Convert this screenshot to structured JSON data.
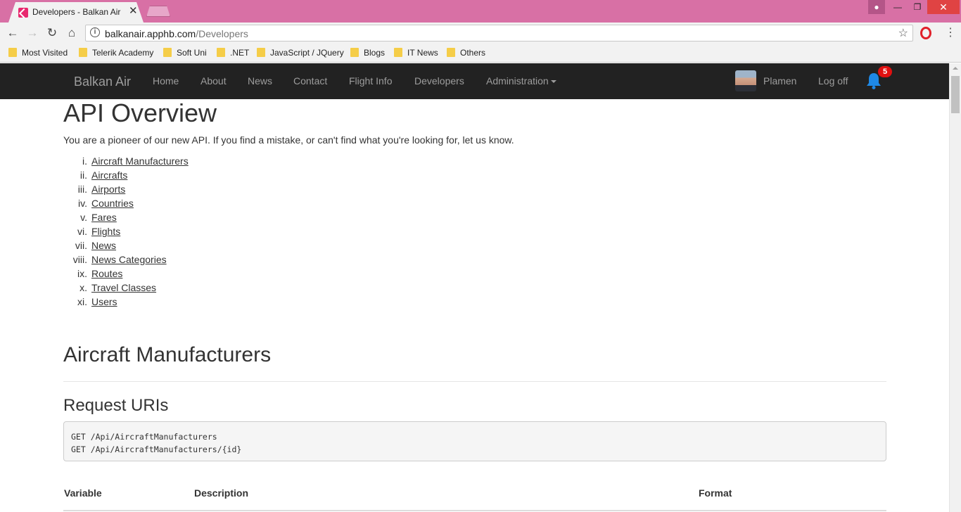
{
  "browser": {
    "tab_title": "Developers - Balkan Air",
    "url_domain": "balkanair.apphb.com",
    "url_path": "/Developers"
  },
  "bookmarks": [
    "Most Visited",
    "Telerik Academy",
    "Soft Uni",
    ".NET",
    "JavaScript / JQuery",
    "Blogs",
    "IT News",
    "Others"
  ],
  "navbar": {
    "brand": "Balkan Air",
    "links": [
      "Home",
      "About",
      "News",
      "Contact",
      "Flight Info",
      "Developers",
      "Administration"
    ],
    "user": "Plamen",
    "logoff": "Log off",
    "notification_count": "5"
  },
  "page": {
    "title": "API Overview",
    "intro": "You are a pioneer of our new API. If you find a mistake, or can't find what you're looking for, let us know.",
    "toc": [
      {
        "num": "i.",
        "label": "Aircraft Manufacturers"
      },
      {
        "num": "ii.",
        "label": "Aircrafts"
      },
      {
        "num": "iii.",
        "label": "Airports"
      },
      {
        "num": "iv.",
        "label": "Countries"
      },
      {
        "num": "v.",
        "label": "Fares"
      },
      {
        "num": "vi.",
        "label": "Flights"
      },
      {
        "num": "vii.",
        "label": "News"
      },
      {
        "num": "viii.",
        "label": "News Categories"
      },
      {
        "num": "ix.",
        "label": "Routes"
      },
      {
        "num": "x.",
        "label": "Travel Classes"
      },
      {
        "num": "xi.",
        "label": "Users"
      }
    ],
    "section_title": "Aircraft Manufacturers",
    "subsection_title": "Request URIs",
    "code_lines": [
      "GET /Api/AircraftManufacturers",
      "GET /Api/AircraftManufacturers/{id}"
    ],
    "table_headers": [
      "Variable",
      "Description",
      "Format"
    ]
  },
  "colors": {
    "tabstrip": "#d870a5",
    "navbar": "#222222",
    "badge": "#e01010",
    "bell": "#1e88e5"
  }
}
